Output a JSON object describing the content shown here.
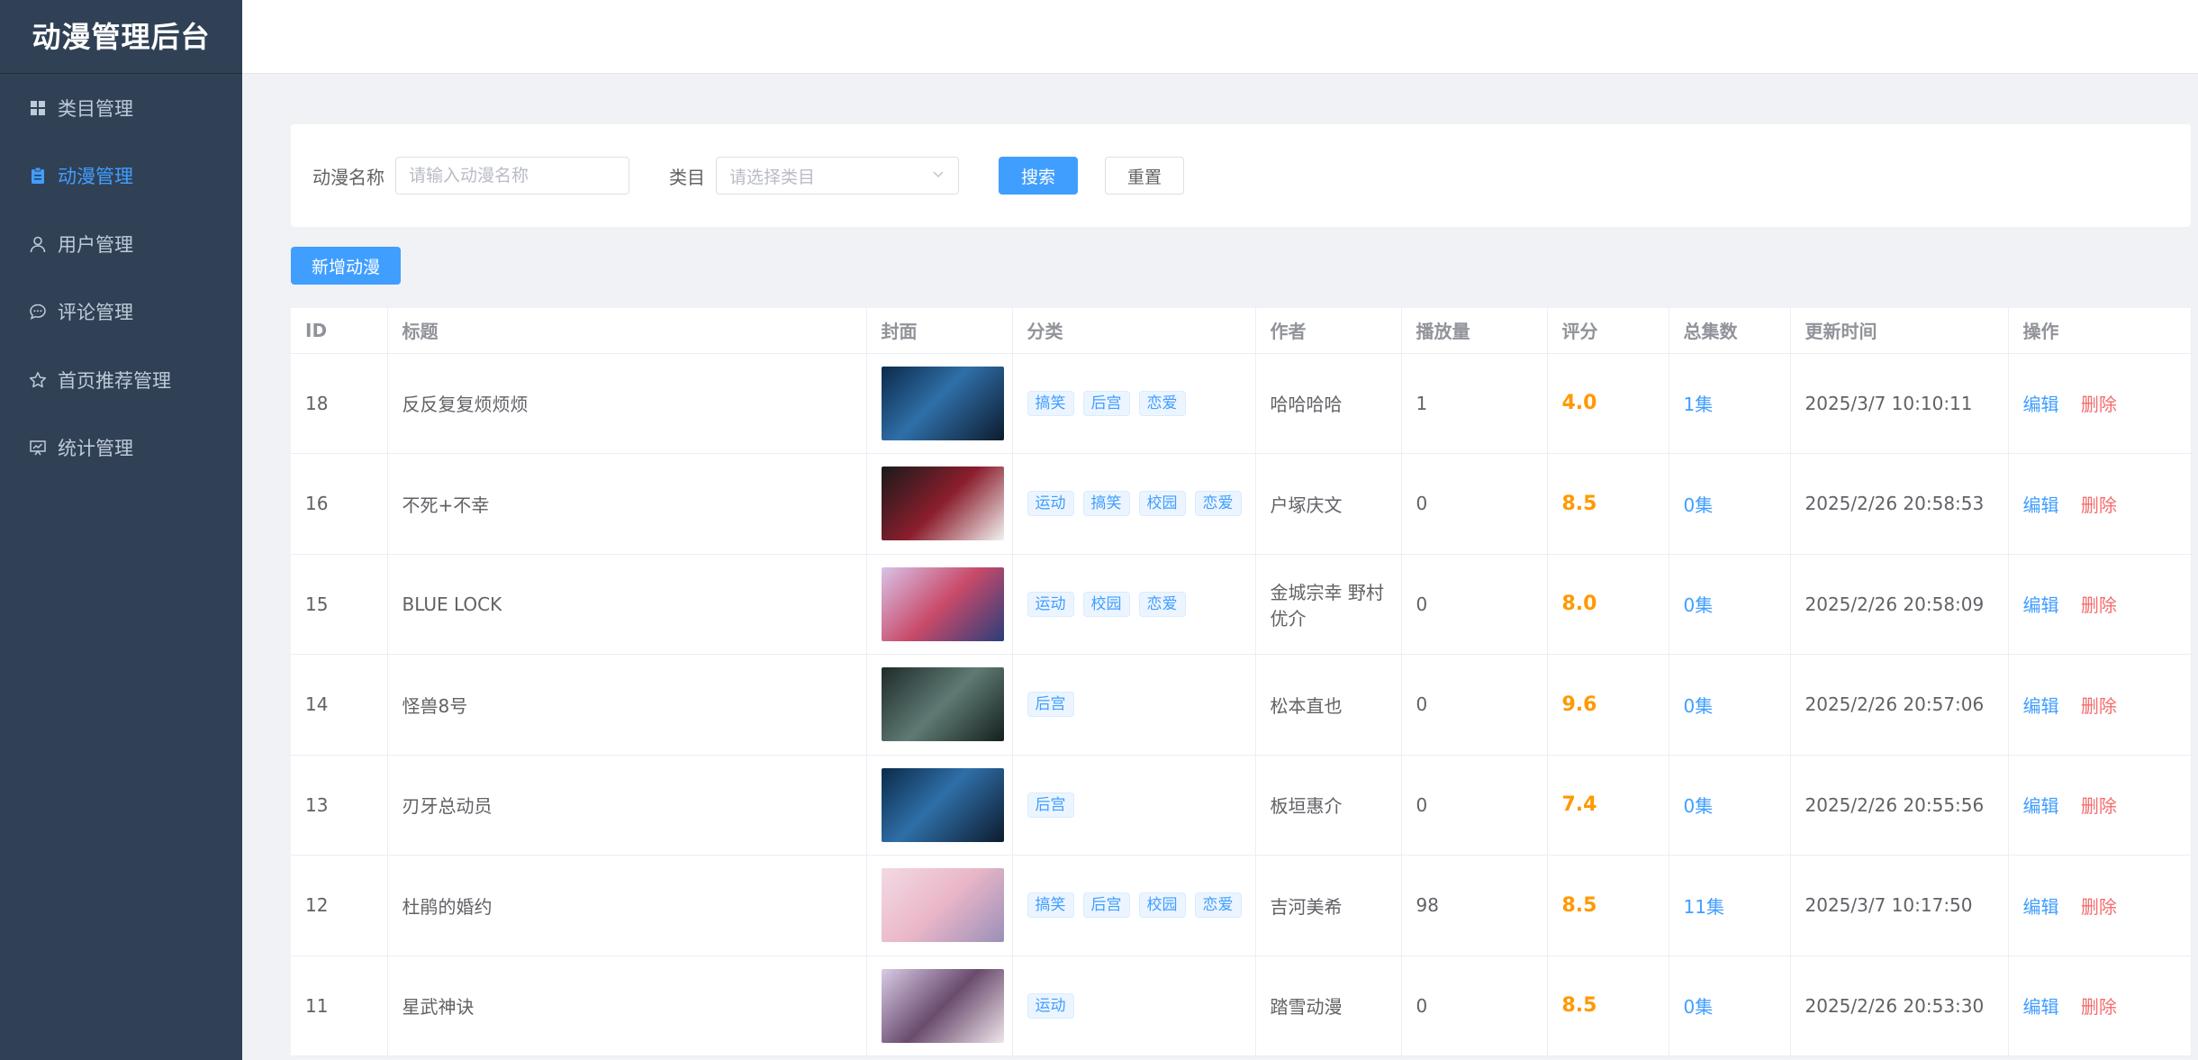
{
  "sidebar": {
    "brand": "动漫管理后台",
    "items": [
      {
        "label": "类目管理"
      },
      {
        "label": "动漫管理"
      },
      {
        "label": "用户管理"
      },
      {
        "label": "评论管理"
      },
      {
        "label": "首页推荐管理"
      },
      {
        "label": "统计管理"
      }
    ],
    "active_index": 1
  },
  "search": {
    "name_label": "动漫名称",
    "name_placeholder": "请输入动漫名称",
    "category_label": "类目",
    "category_placeholder": "请选择类目",
    "search_button": "搜索",
    "reset_button": "重置"
  },
  "toolbar": {
    "add_button": "新增动漫"
  },
  "table": {
    "headers": [
      "ID",
      "标题",
      "封面",
      "分类",
      "作者",
      "播放量",
      "评分",
      "总集数",
      "更新时间",
      "操作"
    ],
    "edit_label": "编辑",
    "delete_label": "删除",
    "rows": [
      {
        "id": "18",
        "title": "反反复复烦烦烦",
        "tags": [
          "搞笑",
          "后宫",
          "恋爱"
        ],
        "author": "哈哈哈哈",
        "plays": "1",
        "score": "4.0",
        "episodes": "1集",
        "updated": "2025/3/7 10:10:11"
      },
      {
        "id": "16",
        "title": "不死+不幸",
        "tags": [
          "运动",
          "搞笑",
          "校园",
          "恋爱"
        ],
        "author": "户塚庆文",
        "plays": "0",
        "score": "8.5",
        "episodes": "0集",
        "updated": "2025/2/26 20:58:53"
      },
      {
        "id": "15",
        "title": "BLUE LOCK",
        "tags": [
          "运动",
          "校园",
          "恋爱"
        ],
        "author": "金城宗幸 野村优介",
        "plays": "0",
        "score": "8.0",
        "episodes": "0集",
        "updated": "2025/2/26 20:58:09"
      },
      {
        "id": "14",
        "title": "怪兽8号",
        "tags": [
          "后宫"
        ],
        "author": "松本直也",
        "plays": "0",
        "score": "9.6",
        "episodes": "0集",
        "updated": "2025/2/26 20:57:06"
      },
      {
        "id": "13",
        "title": "刃牙总动员",
        "tags": [
          "后宫"
        ],
        "author": "板垣惠介",
        "plays": "0",
        "score": "7.4",
        "episodes": "0集",
        "updated": "2025/2/26 20:55:56"
      },
      {
        "id": "12",
        "title": "杜鹃的婚约",
        "tags": [
          "搞笑",
          "后宫",
          "校园",
          "恋爱"
        ],
        "author": "吉河美希",
        "plays": "98",
        "score": "8.5",
        "episodes": "11集",
        "updated": "2025/3/7 10:17:50"
      },
      {
        "id": "11",
        "title": "星武神诀",
        "tags": [
          "运动"
        ],
        "author": "踏雪动漫",
        "plays": "0",
        "score": "8.5",
        "episodes": "0集",
        "updated": "2025/2/26 20:53:30"
      }
    ]
  },
  "colors": {
    "sidebar_bg": "#304156",
    "accent": "#409eff",
    "score": "#ff9900",
    "danger": "#f56c6c"
  }
}
